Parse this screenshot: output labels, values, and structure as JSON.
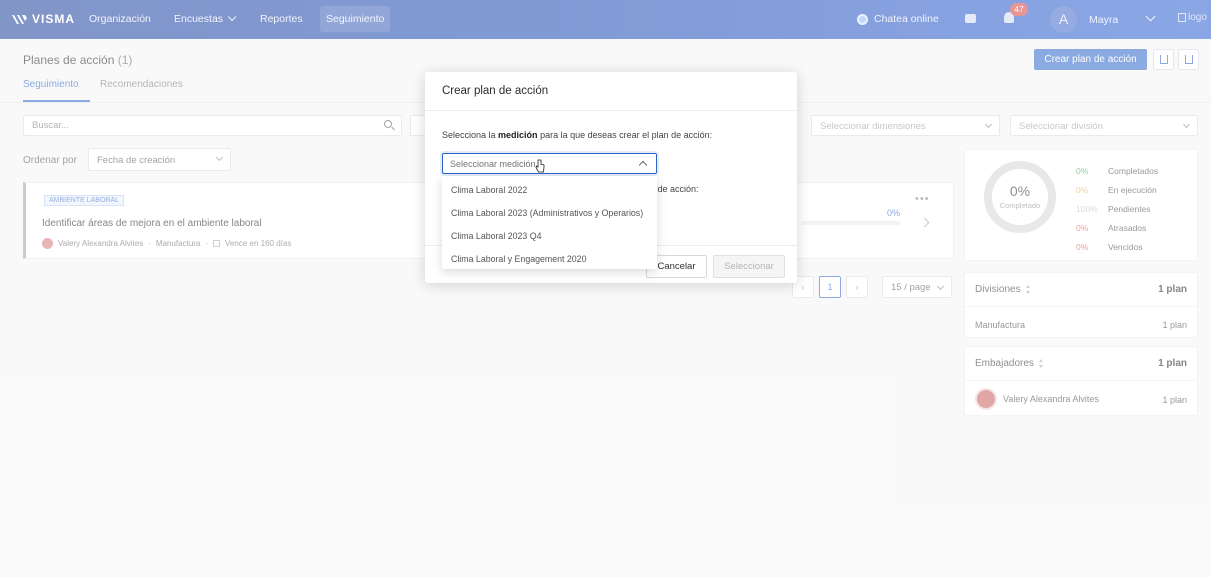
{
  "navbar": {
    "brand": "VISMA",
    "items": [
      "Organización",
      "Encuestas",
      "Reportes",
      "Seguimiento"
    ],
    "active_item": "Seguimiento",
    "chat_label": "Chatea online",
    "notifications_count": "47",
    "avatar_initial": "A",
    "user_name": "Mayra",
    "logo_alt": "logo"
  },
  "header": {
    "title": "Planes de acción",
    "count": "(1)",
    "create_button": "Crear plan de acción",
    "tabs": [
      "Seguimiento",
      "Recomendaciones"
    ],
    "active_tab": "Seguimiento"
  },
  "filters": {
    "search_placeholder": "Buscar...",
    "dimensions_placeholder": "Seleccionar dimensiones",
    "division_placeholder": "Seleccionar división",
    "sort_label": "Ordenar por",
    "sort_value": "Fecha de creación"
  },
  "plan": {
    "tag": "AMBIENTE LABORAL",
    "title": "Identificar áreas de mejora en el ambiente laboral",
    "owner": "Valery Alexandra Alvites",
    "division": "Manufactura",
    "due": "Vence en 160 días",
    "progress_text": "0%",
    "progress": 0
  },
  "pagination": {
    "current_page": "1",
    "page_size": "15 / page"
  },
  "summary": {
    "percent": "0%",
    "percent_label": "Completado",
    "legend": [
      {
        "pct": "0%",
        "label": "Completados",
        "color": "#3aa35c"
      },
      {
        "pct": "0%",
        "label": "En ejecución",
        "color": "#f0a93a"
      },
      {
        "pct": "100%",
        "label": "Pendientes",
        "color": "#bdbdbd"
      },
      {
        "pct": "0%",
        "label": "Atrasados",
        "color": "#e0503f"
      },
      {
        "pct": "0%",
        "label": "Vencidos",
        "color": "#e0503f"
      }
    ]
  },
  "divisions": {
    "title": "Divisiones",
    "total": "1 plan",
    "rows": [
      {
        "label": "Manufactura",
        "count": "1 plan"
      }
    ]
  },
  "ambassadors": {
    "title": "Embajadores",
    "total": "1 plan",
    "rows": [
      {
        "label": "Valery Alexandra Alvites",
        "count": "1 plan"
      }
    ]
  },
  "modal": {
    "title": "Crear plan de acción",
    "instruction_pre": "Selecciona la ",
    "instruction_bold": "medición",
    "instruction_post": " para la que deseas crear el plan de acción:",
    "select_placeholder": "Seleccionar medición",
    "hidden_text": "n de acción:",
    "cancel_button": "Cancelar",
    "select_button": "Seleccionar",
    "options": [
      "Clima Laboral 2022",
      "Clima Laboral 2023 (Administrativos y Operarios)",
      "Clima Laboral 2023 Q4",
      "Clima Laboral y Engagement 2020"
    ]
  },
  "colors": {
    "navbar": "#1a48b5",
    "primary": "#2a64c9"
  }
}
